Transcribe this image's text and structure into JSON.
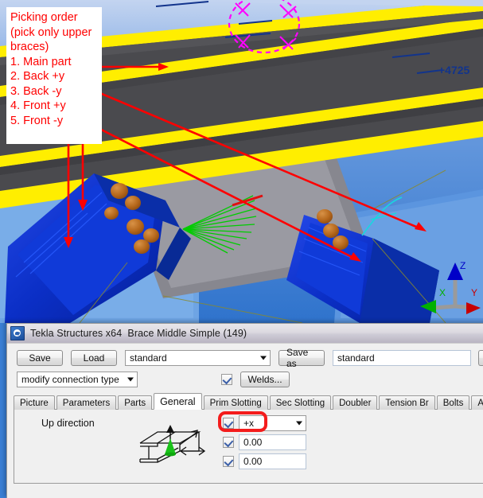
{
  "annotation": {
    "title": "Picking order",
    "subtitle": "(pick only upper braces)",
    "steps": [
      "1. Main part",
      "2. Back +y",
      "3. Back -y",
      "4. Front +y",
      "5. Front -y"
    ],
    "color": "#ff0000",
    "background": "#ffffff"
  },
  "viewport": {
    "elevation_label": "+4725",
    "elevation_color": "#12348c",
    "axis_triad": {
      "x_label": "X",
      "y_label": "Y",
      "z_label": "Z",
      "x_color": "#00b000",
      "y_color": "#c80000",
      "z_color": "#0000c8"
    },
    "background_color": "#3a7fd5",
    "beam_color": "#4a4a4e",
    "beam_edge_color": "#ffee00",
    "brace_color": "#0b35cc",
    "bolt_color": "#b5671b",
    "gusset_color": "#8b8b93",
    "bolt_circle_color": "#ff00ff",
    "arrow_color": "#ff0000",
    "weld_fan_color": "#00cc00"
  },
  "dialog": {
    "title": "Tekla Structures x64  Brace Middle Simple (149)",
    "icon": "tekla-app-icon",
    "toolbar": {
      "save_label": "Save",
      "load_label": "Load",
      "attribute_file": "standard",
      "save_as_label": "Save as",
      "save_as_value": "standard",
      "connection_type": "modify connection type",
      "welds_checked": true,
      "welds_label": "Welds..."
    },
    "tabs": [
      {
        "label": "Picture",
        "active": false
      },
      {
        "label": "Parameters",
        "active": false
      },
      {
        "label": "Parts",
        "active": false
      },
      {
        "label": "General",
        "active": true
      },
      {
        "label": "Prim Slotting",
        "active": false
      },
      {
        "label": "Sec Slotting",
        "active": false
      },
      {
        "label": "Doubler",
        "active": false
      },
      {
        "label": "Tension Br",
        "active": false
      },
      {
        "label": "Bolts",
        "active": false
      },
      {
        "label": "Analysis",
        "active": false
      }
    ],
    "general_tab": {
      "up_direction_label": "Up direction",
      "fields": [
        {
          "checked": true,
          "type": "combo",
          "value": "+x",
          "highlighted": true
        },
        {
          "checked": true,
          "type": "text",
          "value": "0.00",
          "highlighted": false
        },
        {
          "checked": true,
          "type": "text",
          "value": "0.00",
          "highlighted": false
        }
      ],
      "highlight_color": "#f41c1c"
    }
  }
}
